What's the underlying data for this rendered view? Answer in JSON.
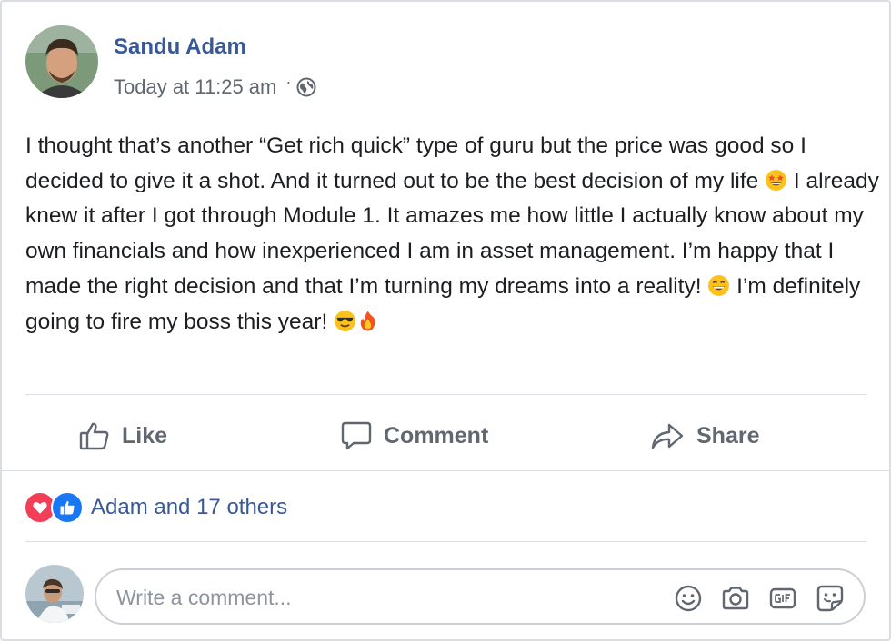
{
  "post": {
    "author": "Sandu Adam",
    "timestamp": "Today at 11:25 am",
    "meta_separator": "·",
    "privacy_icon": "globe-icon",
    "text": {
      "p1": "I thought that’s another “Get rich quick” type of guru but the price was good so I decided to give it a shot. And it turned out to be the best decision of my life ",
      "emoji1": "star-struck-emoji",
      "p2": " I already knew it after I got through Module 1. It amazes me how little I actually know about my own financials and how inexperienced I am in asset management. I’m happy that I made the right decision and that I’m turning my dreams into a reality! ",
      "emoji2": "grinning-emoji",
      "p3": " I’m definitely going to fire my boss this year! ",
      "emoji3": "sunglasses-emoji",
      "emoji4": "fire-emoji"
    }
  },
  "actions": {
    "like": "Like",
    "comment": "Comment",
    "share": "Share"
  },
  "reactions": {
    "icons": [
      "love-icon",
      "like-icon"
    ],
    "summary": "Adam and 17 others"
  },
  "comment_box": {
    "placeholder": "Write a comment...",
    "icons": [
      "emoji-icon",
      "camera-icon",
      "gif-icon",
      "sticker-icon"
    ]
  },
  "colors": {
    "link": "#385898",
    "text": "#1c1e21",
    "muted": "#616770",
    "love": "#f33e58",
    "like": "#1877f2"
  }
}
